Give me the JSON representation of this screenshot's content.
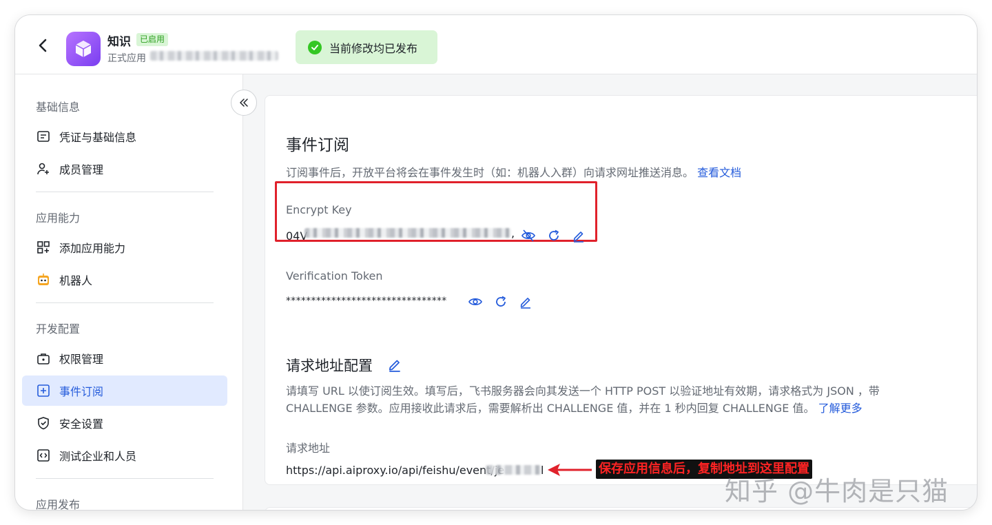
{
  "header": {
    "app_name": "知识",
    "app_status_badge": "已启用",
    "app_type": "正式应用",
    "publish_status": "当前修改均已发布"
  },
  "sidebar": {
    "sections": [
      {
        "title": "基础信息",
        "items": [
          {
            "label": "凭证与基础信息",
            "icon": "credential-icon"
          },
          {
            "label": "成员管理",
            "icon": "member-add-icon"
          }
        ]
      },
      {
        "title": "应用能力",
        "items": [
          {
            "label": "添加应用能力",
            "icon": "grid-add-icon"
          },
          {
            "label": "机器人",
            "icon": "robot-icon"
          }
        ]
      },
      {
        "title": "开发配置",
        "items": [
          {
            "label": "权限管理",
            "icon": "permission-icon"
          },
          {
            "label": "事件订阅",
            "icon": "event-subscription-icon",
            "active": true
          },
          {
            "label": "安全设置",
            "icon": "shield-icon"
          },
          {
            "label": "测试企业和人员",
            "icon": "test-code-icon"
          }
        ]
      },
      {
        "title": "应用发布",
        "items": []
      }
    ]
  },
  "main": {
    "title": "事件订阅",
    "description": "订阅事件后，开放平台将会在事件发生时（如：机器人入群）向请求网址推送消息。",
    "doc_link": "查看文档",
    "encrypt_key": {
      "label": "Encrypt Key",
      "value_prefix": "04V",
      "value_suffix": ","
    },
    "verification_token": {
      "label": "Verification Token",
      "value": "********************************"
    },
    "request_config": {
      "title": "请求地址配置",
      "paragraph_line1": "请填写 URL 以使订阅生效。填写后，飞书服务器会向其发送一个 HTTP POST 以验证地址有效期，请求格式为 JSON ，带",
      "paragraph_line2": "CHALLENGE 参数。应用接收此请求后，需要解析出 CHALLENGE 值，并在 1 秒内回复 CHALLENGE 值。",
      "learn_more": "了解更多",
      "url_label": "请求地址",
      "url_prefix": "https://api.aiproxy.io/api/feishu/event/je",
      "url_suffix": "l"
    },
    "annotation": "保存应用信息后，复制地址到这里配置"
  },
  "watermark": "知乎 @牛肉是只猫",
  "colors": {
    "accent": "#245bdb",
    "highlight_border": "#e0212b",
    "annotation_text": "#ff2323",
    "success_bg": "#d9f5d6"
  }
}
